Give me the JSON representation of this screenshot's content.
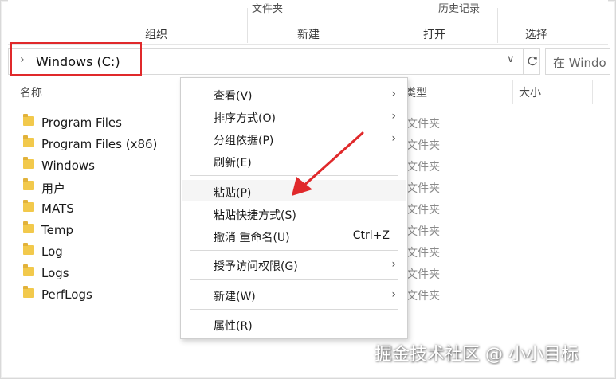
{
  "ribbon": {
    "top_cut_left": "文件夹",
    "top_cut_right": "历史记录",
    "groups": [
      "组织",
      "新建",
      "打开",
      "选择"
    ]
  },
  "address": {
    "path": "Windows (C:)",
    "search_placeholder": "在 Windo"
  },
  "columns": {
    "name": "名称",
    "type": "类型",
    "size": "大小"
  },
  "files": [
    {
      "name": "Program Files",
      "type": "文件夹"
    },
    {
      "name": "Program Files (x86)",
      "type": "文件夹"
    },
    {
      "name": "Windows",
      "type": "文件夹"
    },
    {
      "name": "用户",
      "type": "文件夹"
    },
    {
      "name": "MATS",
      "type": "文件夹"
    },
    {
      "name": "Temp",
      "type": "文件夹"
    },
    {
      "name": "Log",
      "type": "文件夹"
    },
    {
      "name": "Logs",
      "type": "文件夹"
    },
    {
      "name": "PerfLogs",
      "type": "文件夹"
    }
  ],
  "context_menu": {
    "view": "查看(V)",
    "sort": "排序方式(O)",
    "group": "分组依据(P)",
    "refresh": "刷新(E)",
    "paste": "粘贴(P)",
    "paste_shortcut": "粘贴快捷方式(S)",
    "undo": "撤消 重命名(U)",
    "undo_shortcut": "Ctrl+Z",
    "grant_access": "授予访问权限(G)",
    "new": "新建(W)",
    "properties": "属性(R)"
  },
  "watermark": "掘金技术社区 @ 小小目标",
  "colors": {
    "highlight_red": "#e0292b",
    "folder_yellow": "#f2c94c"
  }
}
